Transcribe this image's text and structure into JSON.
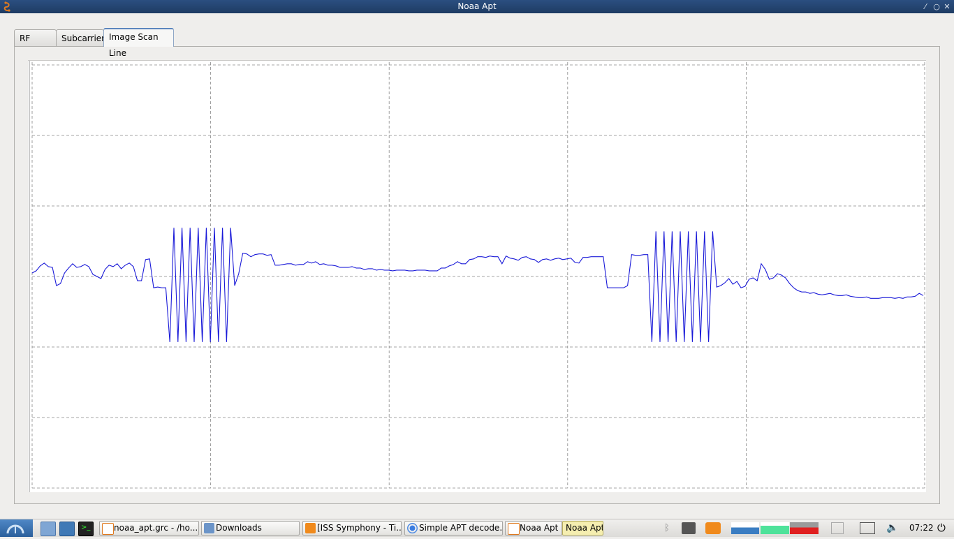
{
  "window": {
    "title": "Noaa Apt"
  },
  "tabs": [
    {
      "label": "RF Input"
    },
    {
      "label": "Subcarrier"
    },
    {
      "label": "Image Scan Line"
    }
  ],
  "active_tab": "Image Scan Line",
  "colors": {
    "trace": "#1a1ad8",
    "grid": "#888888",
    "titlebar": "#1e3b63"
  },
  "chart_data": {
    "type": "line",
    "grid": true,
    "series": [
      {
        "values": [
          0.05,
          0.08,
          0.15,
          0.19,
          0.14,
          0.13,
          -0.13,
          -0.1,
          0.05,
          0.12,
          0.18,
          0.13,
          0.14,
          0.17,
          0.14,
          0.03,
          0.0,
          -0.03,
          0.1,
          0.16,
          0.14,
          0.18,
          0.11,
          0.16,
          0.19,
          0.14,
          -0.06,
          -0.06,
          0.24,
          0.25,
          -0.16,
          -0.15,
          -0.16,
          -0.16,
          -0.13,
          0.04,
          0.33,
          0.32,
          0.28,
          0.31,
          0.32,
          0.32,
          0.3,
          0.31,
          0.16,
          0.16,
          0.17,
          0.18,
          0.18,
          0.16,
          0.17,
          0.17,
          0.21,
          0.19,
          0.21,
          0.17,
          0.18,
          0.16,
          0.16,
          0.15,
          0.13,
          0.13,
          0.13,
          0.14,
          0.12,
          0.12,
          0.1,
          0.11,
          0.11,
          0.09,
          0.1,
          0.09,
          0.09,
          0.08,
          0.09,
          0.09,
          0.09,
          0.08,
          0.08,
          0.09,
          0.09,
          0.09,
          0.08,
          0.08,
          0.08,
          0.12,
          0.12,
          0.15,
          0.17,
          0.21,
          0.18,
          0.18,
          0.24,
          0.25,
          0.28,
          0.28,
          0.27,
          0.29,
          0.28,
          0.28,
          0.18,
          0.29,
          0.26,
          0.25,
          0.23,
          0.27,
          0.28,
          0.25,
          0.24,
          0.2,
          0.24,
          0.25,
          0.23,
          0.25,
          0.26,
          0.24,
          0.25,
          0.26,
          0.2,
          0.19,
          0.27,
          0.27,
          0.28,
          0.28,
          0.28,
          0.28,
          -0.16,
          -0.16,
          -0.16,
          -0.16,
          -0.16,
          -0.13,
          0.31,
          0.3,
          0.3,
          0.31,
          0.31,
          -0.15,
          -0.13,
          -0.09,
          -0.03,
          -0.11,
          -0.07,
          -0.16,
          -0.14,
          -0.04,
          -0.02,
          -0.06,
          0.18,
          0.1,
          -0.04,
          -0.02,
          0.04,
          0.02,
          -0.02,
          -0.1,
          -0.16,
          -0.2,
          -0.22,
          -0.22,
          -0.24,
          -0.23,
          -0.25,
          -0.26,
          -0.25,
          -0.24,
          -0.26,
          -0.27,
          -0.27,
          -0.26,
          -0.28,
          -0.29,
          -0.3,
          -0.3,
          -0.29,
          -0.31,
          -0.31,
          -0.31,
          -0.3,
          -0.3,
          -0.3,
          -0.31,
          -0.3,
          -0.31,
          -0.29,
          -0.29,
          -0.28,
          -0.24,
          -0.27
        ],
        "bursts": [
          {
            "after_index": 33,
            "low": -0.93,
            "high": 0.69
          },
          {
            "after_index": 136,
            "low": -0.93,
            "high": 0.64
          }
        ]
      }
    ],
    "ylim": [
      -3,
      3
    ]
  },
  "taskbar": {
    "tasks": [
      {
        "label": "noaa_apt.grc - /ho...",
        "icon": "gnuradio-icon"
      },
      {
        "label": "Downloads",
        "icon": "folder-icon"
      },
      {
        "label": "[ISS Symphony - Ti...",
        "icon": "vlc-icon"
      },
      {
        "label": "Simple APT decode...",
        "icon": "chromium-icon"
      },
      {
        "label": "Noaa Apt",
        "icon": "gnuradio-icon"
      },
      {
        "label": "Noaa Apt",
        "icon": ""
      }
    ],
    "clock": "07:22"
  }
}
